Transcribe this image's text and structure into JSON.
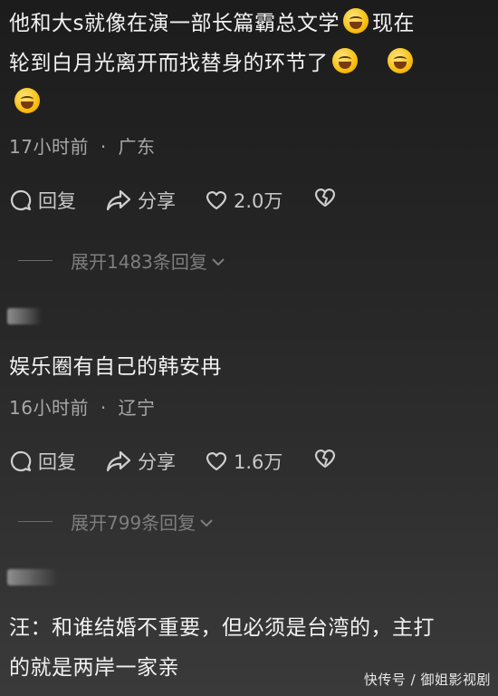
{
  "comments": [
    {
      "text_lines": [
        "他和大s就像在演一部长篇霸总文学",
        "现在",
        "轮到白月光离开而找替身的环节了"
      ],
      "time": "17小时前",
      "location": "广东",
      "reply_label": "回复",
      "share_label": "分享",
      "likes": "2.0万",
      "expand_label": "展开1483条回复"
    },
    {
      "text": "娱乐圈有自己的韩安冉",
      "time": "16小时前",
      "location": "辽宁",
      "reply_label": "回复",
      "share_label": "分享",
      "likes": "1.6万",
      "expand_label": "展开799条回复"
    },
    {
      "text_lines": [
        "汪：和谁结婚不重要，但必须是台湾的，主打",
        "的就是两岸一家亲"
      ]
    }
  ],
  "meta_separator": "·",
  "icons": {
    "reply": "comment-bubble-icon",
    "share": "share-arrow-icon",
    "like": "heart-icon",
    "dislike": "broken-heart-icon",
    "expand": "chevron-down-icon",
    "emoji": "laughing-tears-emoji-icon"
  },
  "watermark": "快传号 / 御姐影视剧"
}
